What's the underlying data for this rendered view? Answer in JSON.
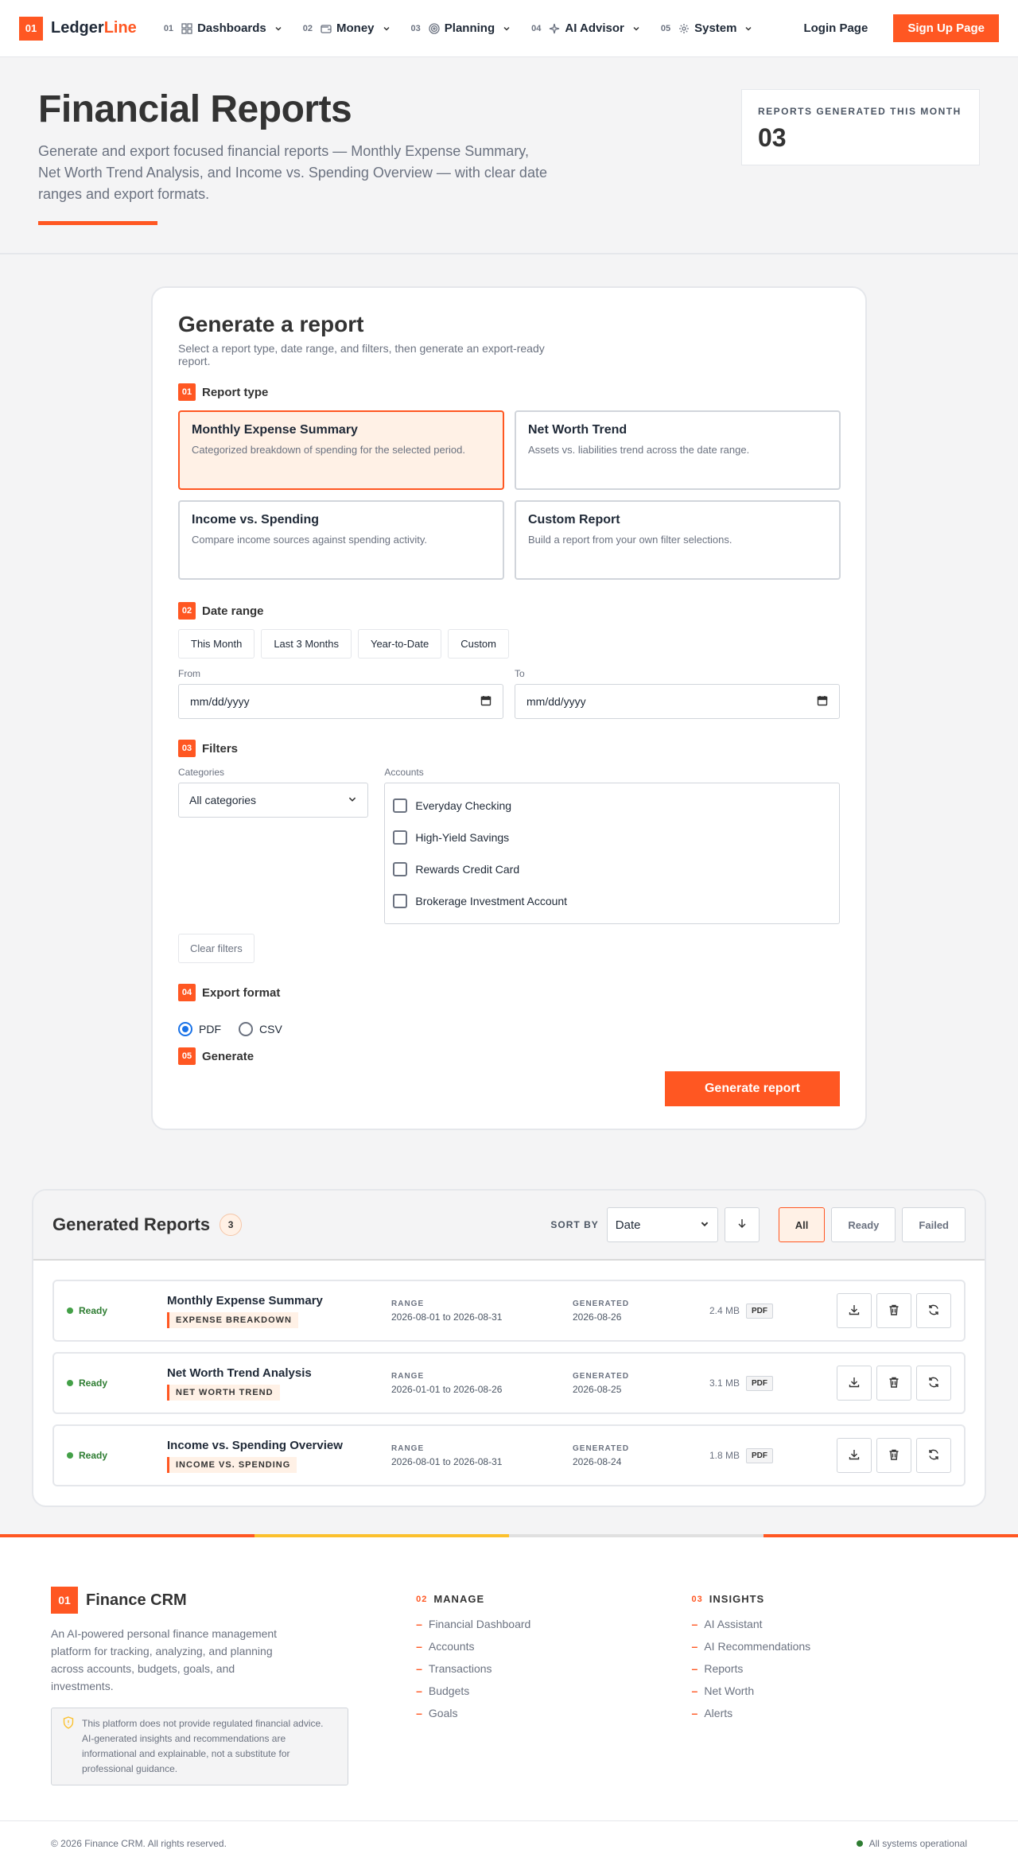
{
  "nav": {
    "brand_badge": "01",
    "brand_name_primary": "Ledger",
    "brand_name_accent": "Line",
    "items": [
      {
        "num": "01",
        "label": "Dashboards",
        "icon": "grid-icon"
      },
      {
        "num": "02",
        "label": "Money",
        "icon": "wallet-icon"
      },
      {
        "num": "03",
        "label": "Planning",
        "icon": "target-icon"
      },
      {
        "num": "04",
        "label": "AI Advisor",
        "icon": "sparkle-icon"
      },
      {
        "num": "05",
        "label": "System",
        "icon": "gear-icon"
      }
    ],
    "login_label": "Login Page",
    "signup_label": "Sign Up Page"
  },
  "hero": {
    "title": "Financial Reports",
    "subtitle": "Generate and export focused financial reports — Monthly Expense Summary, Net Worth Trend Analysis, and Income vs. Spending Overview — with clear date ranges and export formats.",
    "stat_label": "REPORTS GENERATED THIS MONTH",
    "stat_value": "03"
  },
  "generate": {
    "title": "Generate a report",
    "subtitle": "Select a report type, date range, and filters, then generate an export-ready report.",
    "steps": [
      {
        "num": "01",
        "label": "Report type"
      },
      {
        "num": "02",
        "label": "Date range"
      },
      {
        "num": "03",
        "label": "Filters"
      },
      {
        "num": "04",
        "label": "Export format"
      },
      {
        "num": "05",
        "label": "Generate"
      }
    ],
    "report_types": [
      {
        "title": "Monthly Expense Summary",
        "desc": "Categorized breakdown of spending for the selected period.",
        "selected": true
      },
      {
        "title": "Net Worth Trend",
        "desc": "Assets vs. liabilities trend across the date range.",
        "selected": false
      },
      {
        "title": "Income vs. Spending",
        "desc": "Compare income sources against spending activity.",
        "selected": false
      },
      {
        "title": "Custom Report",
        "desc": "Build a report from your own filter selections.",
        "selected": false
      }
    ],
    "range_options": [
      "This Month",
      "Last 3 Months",
      "Year-to-Date",
      "Custom"
    ],
    "from_label": "From",
    "to_label": "To",
    "from_value": "mm/dd/yyyy",
    "to_value": "mm/dd/yyyy",
    "categories_label": "Categories",
    "categories_value": "All categories",
    "accounts_label": "Accounts",
    "accounts": [
      "Everyday Checking",
      "High-Yield Savings",
      "Rewards Credit Card",
      "Brokerage Investment Account"
    ],
    "clear_label": "Clear filters",
    "formats": [
      {
        "label": "PDF",
        "checked": true
      },
      {
        "label": "CSV",
        "checked": false
      }
    ],
    "generate_label": "Generate report"
  },
  "reports": {
    "title": "Generated Reports",
    "count": "3",
    "sort_label": "SORT BY",
    "sort_value": "Date",
    "tabs": [
      {
        "label": "All",
        "active": true
      },
      {
        "label": "Ready",
        "active": false
      },
      {
        "label": "Failed",
        "active": false
      }
    ],
    "range_label": "RANGE",
    "generated_label": "GENERATED",
    "rows": [
      {
        "status": "Ready",
        "name": "Monthly Expense Summary",
        "tag": "EXPENSE BREAKDOWN",
        "range": "2026-08-01 to 2026-08-31",
        "generated": "2026-08-26",
        "size": "2.4 MB",
        "format": "PDF"
      },
      {
        "status": "Ready",
        "name": "Net Worth Trend Analysis",
        "tag": "NET WORTH TREND",
        "range": "2026-01-01 to 2026-08-26",
        "generated": "2026-08-25",
        "size": "3.1 MB",
        "format": "PDF"
      },
      {
        "status": "Ready",
        "name": "Income vs. Spending Overview",
        "tag": "INCOME VS. SPENDING",
        "range": "2026-08-01 to 2026-08-31",
        "generated": "2026-08-24",
        "size": "1.8 MB",
        "format": "PDF"
      }
    ]
  },
  "footer": {
    "badge": "01",
    "name": "Finance CRM",
    "desc": "An AI-powered personal finance management platform for tracking, analyzing, and planning across accounts, budgets, goals, and investments.",
    "notice": "This platform does not provide regulated financial advice. AI-generated insights and recommendations are informational and explainable, not a substitute for professional guidance.",
    "manage": {
      "num": "02",
      "title": "MANAGE",
      "links": [
        "Financial Dashboard",
        "Accounts",
        "Transactions",
        "Budgets",
        "Goals"
      ]
    },
    "insights": {
      "num": "03",
      "title": "INSIGHTS",
      "links": [
        "AI Assistant",
        "AI Recommendations",
        "Reports",
        "Net Worth",
        "Alerts"
      ]
    },
    "copyright": "© 2026 Finance CRM. All rights reserved.",
    "status": "All systems operational"
  },
  "colors": {
    "accent": "#ff5722",
    "accent_soft": "#fff1e6",
    "ready_green": "#2e7d32",
    "stripe": [
      "#ff5722",
      "#fbc02d",
      "#e0e0e0",
      "#ff5722"
    ]
  }
}
